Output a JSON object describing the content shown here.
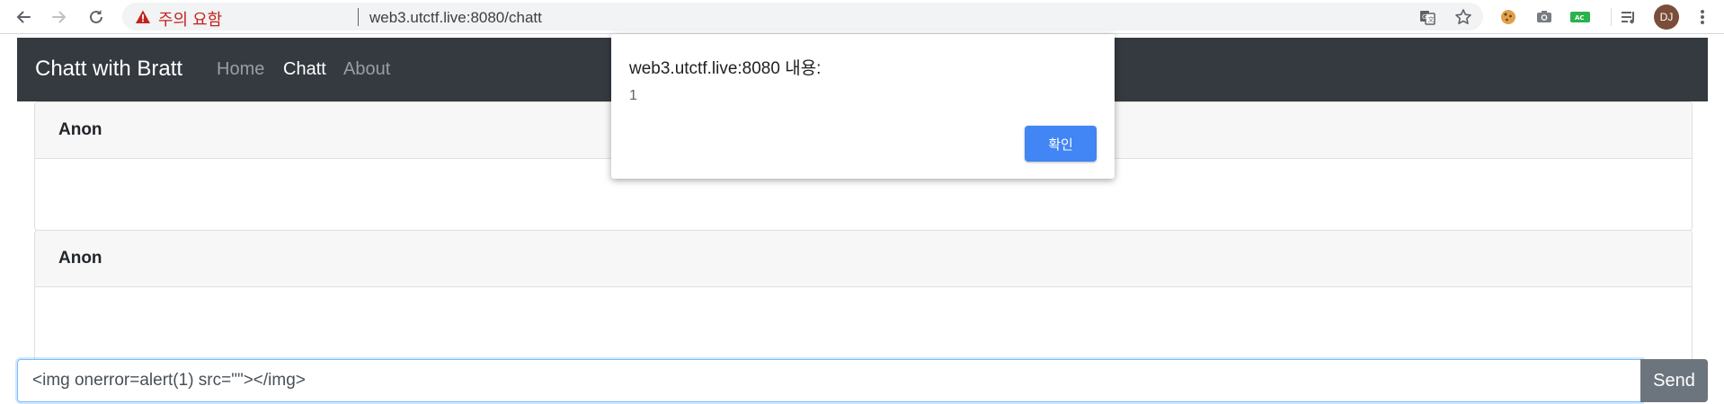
{
  "browser": {
    "security_warning": "주의 요함",
    "url": "web3.utctf.live:8080/chatt",
    "avatar_initials": "DJ",
    "icons": [
      "back-arrow-icon",
      "forward-arrow-icon",
      "reload-icon",
      "warning-triangle-icon",
      "translate-icon",
      "bookmark-star-icon",
      "cookie-extension-icon",
      "camera-extension-icon",
      "ac-extension-icon",
      "media-queue-icon",
      "kebab-menu-icon"
    ],
    "accent_color": "#c5221f"
  },
  "navbar": {
    "brand": "Chatt with Bratt",
    "links": [
      {
        "label": "Home",
        "active": false
      },
      {
        "label": "Chatt",
        "active": true
      },
      {
        "label": "About",
        "active": false
      }
    ],
    "background": "#343a40"
  },
  "messages": [
    {
      "author": "Anon",
      "body": ""
    },
    {
      "author": "Anon",
      "body": ""
    }
  ],
  "composer": {
    "input_value": "<img onerror=alert(1) src=\"\"></img>",
    "send_label": "Send"
  },
  "alert_dialog": {
    "title": "web3.utctf.live:8080 내용:",
    "message": "1",
    "ok_label": "확인",
    "button_color": "#4285f4"
  }
}
